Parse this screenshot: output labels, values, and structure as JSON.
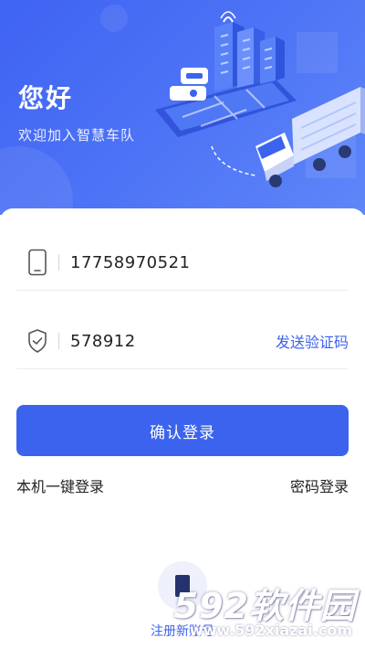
{
  "header": {
    "greeting": "您好",
    "subtitle": "欢迎加入智慧车队"
  },
  "login_form": {
    "phone_value": "17758970521",
    "code_value": "578912",
    "send_code_label": "发送验证码",
    "login_button_label": "确认登录"
  },
  "alt_login": {
    "one_click_label": "本机一键登录",
    "password_label": "密码登录"
  },
  "register": {
    "label": "注册新账号"
  },
  "watermark": {
    "logo_text": "592软件园",
    "url": "www.592xiazai.com"
  },
  "colors": {
    "brand": "#3c63ee",
    "hero_gradient_start": "#3f63f2",
    "hero_gradient_end": "#5f86f8"
  },
  "icons": [
    "phone-icon",
    "shield-check-icon",
    "user-plus-icon",
    "city-truck-illustration"
  ]
}
